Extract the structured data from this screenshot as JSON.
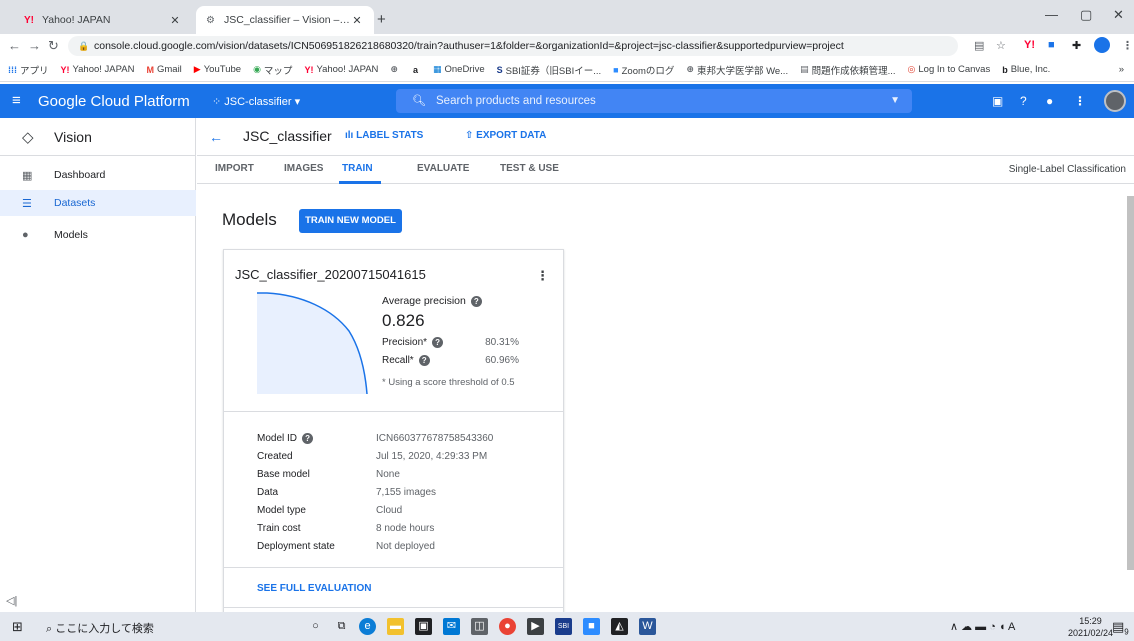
{
  "browser": {
    "tabs": [
      {
        "favicon": "Y!",
        "title": "Yahoo! JAPAN",
        "active": false
      },
      {
        "favicon": "⚙",
        "title": "JSC_classifier – Vision – JSC-class",
        "active": true
      }
    ],
    "new_tab": "+",
    "url": "console.cloud.google.com/vision/datasets/ICN5069518262186803​20/train?authuser=1&folder=&organizationId=&project=jsc-classifier&supportedpurview=project",
    "bookmarks": [
      {
        "icon": "apps-icon",
        "label": "アプリ"
      },
      {
        "icon": "yahoo-icon",
        "label": "Yahoo! JAPAN"
      },
      {
        "icon": "gmail-icon",
        "label": "Gmail"
      },
      {
        "icon": "youtube-icon",
        "label": "YouTube"
      },
      {
        "icon": "maps-icon",
        "label": "マップ"
      },
      {
        "icon": "yahoo-icon",
        "label": "Yahoo! JAPAN"
      },
      {
        "icon": "web-icon",
        "label": ""
      },
      {
        "icon": "amazon-icon",
        "label": ""
      },
      {
        "icon": "onedrive-icon",
        "label": "OneDrive"
      },
      {
        "icon": "sbi-icon",
        "label": "SBI証券（旧SBIイー..."
      },
      {
        "icon": "zoom-icon",
        "label": "Zoomのログ"
      },
      {
        "icon": "web-icon",
        "label": "東邦大学医学部 We..."
      },
      {
        "icon": "doc-icon",
        "label": "問題作成依頼管理..."
      },
      {
        "icon": "canvas-icon",
        "label": "Log In to Canvas"
      },
      {
        "icon": "blue-icon",
        "label": "Blue, Inc."
      }
    ],
    "bookmarks_more": "»"
  },
  "gcp": {
    "title": "Google Cloud Platform",
    "project": "JSC-classifier",
    "search_placeholder": "Search products and resources"
  },
  "sidebar": {
    "product": "Vision",
    "items": [
      {
        "label": "Dashboard",
        "selected": false
      },
      {
        "label": "Datasets",
        "selected": true
      },
      {
        "label": "Models",
        "selected": false
      }
    ]
  },
  "header": {
    "dataset_title": "JSC_classifier",
    "label_stats": "LABEL STATS",
    "export_data": "EXPORT DATA"
  },
  "tabs": [
    {
      "label": "IMPORT",
      "selected": false
    },
    {
      "label": "IMAGES",
      "selected": false
    },
    {
      "label": "TRAIN",
      "selected": true
    },
    {
      "label": "EVALUATE",
      "selected": false
    },
    {
      "label": "TEST & USE",
      "selected": false
    }
  ],
  "classification_type": "Single-Label Classification",
  "main": {
    "models_title": "Models",
    "train_button": "TRAIN NEW MODEL",
    "card": {
      "name": "JSC_classifier_20200715041615",
      "avg_precision_label": "Average precision",
      "avg_precision_value": "0.826",
      "precision_label": "Precision*",
      "precision_value": "80.31%",
      "recall_label": "Recall*",
      "recall_value": "60.96%",
      "threshold_note": "* Using a score threshold of 0.5",
      "details": [
        {
          "label": "Model ID",
          "value": "ICN660377678758543360",
          "help": true
        },
        {
          "label": "Created",
          "value": "Jul 15, 2020, 4:29:33 PM"
        },
        {
          "label": "Base model",
          "value": "None"
        },
        {
          "label": "Data",
          "value": "7,155 images"
        },
        {
          "label": "Model type",
          "value": "Cloud"
        },
        {
          "label": "Train cost",
          "value": "8 node hours"
        },
        {
          "label": "Deployment state",
          "value": "Not deployed"
        }
      ],
      "see_full": "SEE FULL EVALUATION"
    }
  },
  "taskbar": {
    "search_placeholder": "ここに入力して検索",
    "time": "15:29",
    "date": "2021/02/24",
    "notifications": "9"
  },
  "colors": {
    "accent": "#1a73e8",
    "chart_fill": "#e8f0fe",
    "chart_line": "#1a73e8"
  }
}
